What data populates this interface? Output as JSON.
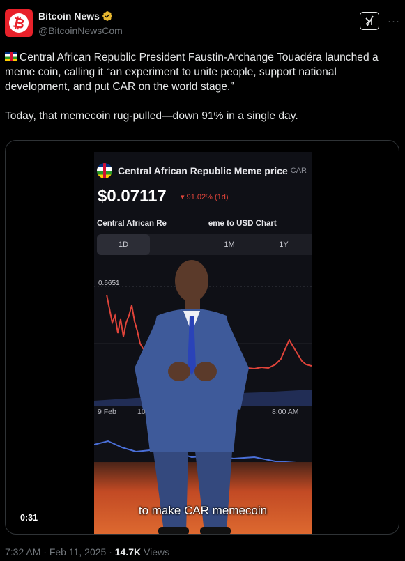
{
  "author": {
    "name": "Bitcoin News",
    "handle": "@BitcoinNewsCom",
    "avatar_glyph": "₿",
    "brand_color": "#e8212a",
    "verified_color": "#e8b730"
  },
  "header": {
    "grok_icon": "grok-slash-icon",
    "more_label": "···"
  },
  "tweet": {
    "line1": "Central African Republic President Faustin-Archange Touadéra launched a meme coin, calling it “an experiment to unite people, support national development, and put CAR on the world stage.”",
    "line2": "Today, that memecoin rug-pulled—down 91% in a single day."
  },
  "video": {
    "duration": "0:31",
    "caption": "to make CAR memecoin",
    "screen": {
      "title": "Central African Republic Meme price",
      "title_suffix": "CAR",
      "price": "$0.07117",
      "change": "▾ 91.02% (1d)",
      "chart_title": "Central African Re",
      "chart_title_end": "eme to USD Chart",
      "timeframes": [
        "1D",
        "1M",
        "1Y"
      ],
      "ref_value": "0.6651",
      "x_labels": [
        "9 Feb",
        "10 Fe",
        "8:00 AM"
      ],
      "accent_red": "#e0443a",
      "accent_blue": "#4a6fd8"
    }
  },
  "footer": {
    "time": "7:32 AM",
    "date": "Feb 11, 2025",
    "views_count": "14.7K",
    "views_label": "Views"
  }
}
